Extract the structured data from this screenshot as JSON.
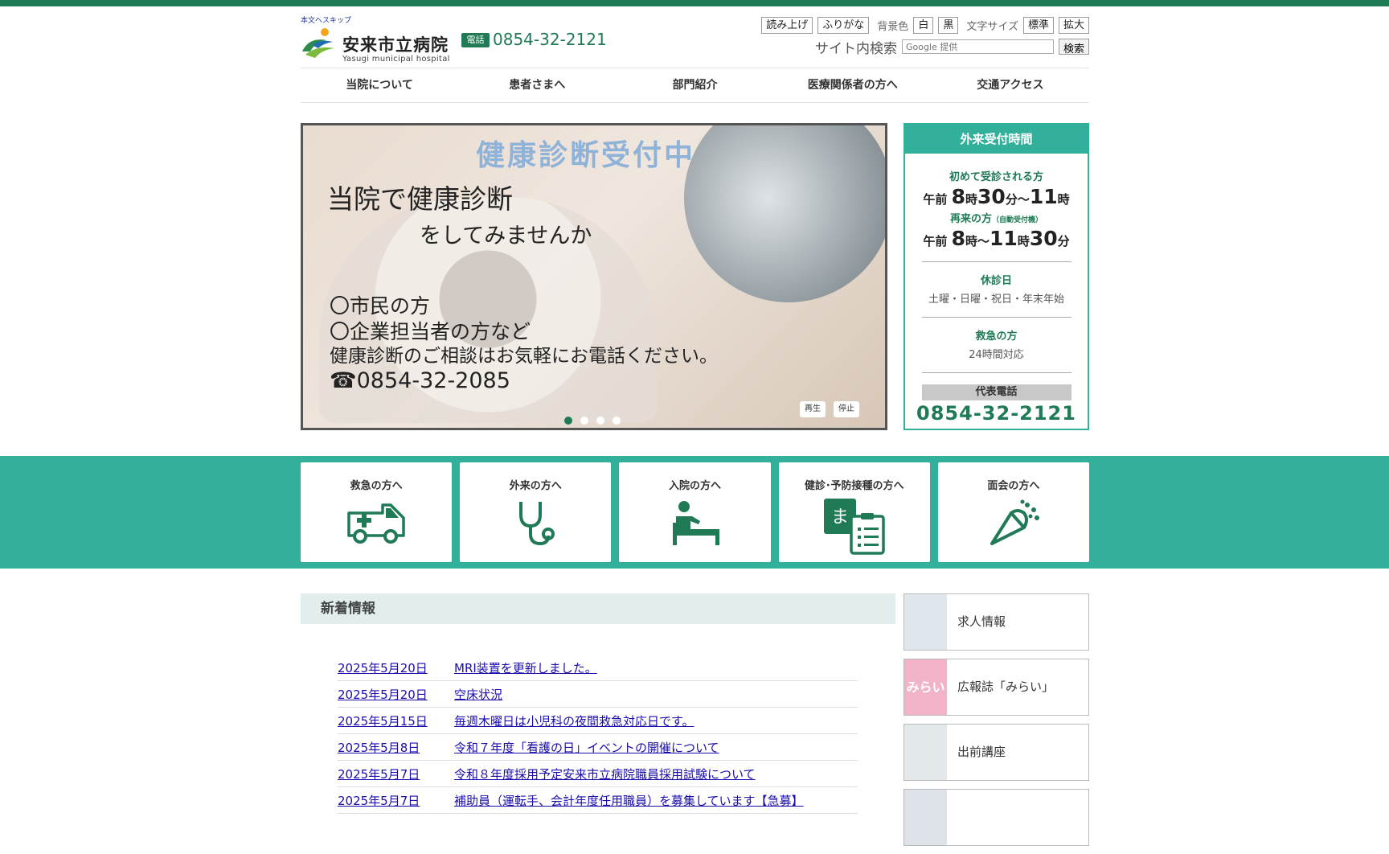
{
  "header": {
    "skip_link": "本文へスキップ",
    "hospital_name": "安来市立病院",
    "hospital_name_en": "Yasugi municipal hospital",
    "tel_badge": "電話",
    "tel_number": "0854-32-2121"
  },
  "utility": {
    "read_aloud": "読み上げ",
    "furigana": "ふりがな",
    "bg_color_label": "背景色",
    "bg_white": "白",
    "bg_black": "黒",
    "font_size_label": "文字サイズ",
    "font_standard": "標準",
    "font_large": "拡大"
  },
  "search": {
    "label": "サイト内検索",
    "placeholder": "Google 提供",
    "button": "検索"
  },
  "nav": {
    "items": [
      "当院について",
      "患者さまへ",
      "部門紹介",
      "医療関係者の方へ",
      "交通アクセス"
    ]
  },
  "slider": {
    "headline": "健康診断受付中",
    "line1": "当院で健康診断",
    "line2": "をしてみませんか",
    "line3": "〇市民の方",
    "line4": "〇企業担当者の方など",
    "line5": "健康診断のご相談はお気軽にお電話ください。",
    "line6": "☎0854-32-2085",
    "play": "再生",
    "stop": "停止",
    "slide_count": 4,
    "active_slide": 1
  },
  "hours": {
    "title": "外来受付時間",
    "first_visit_label": "初めて受診される方",
    "first_visit_time": [
      "午前",
      "8",
      "時",
      "30",
      "分〜",
      "11",
      "時"
    ],
    "return_visit_label": "再来の方",
    "return_visit_note": "（自動受付機）",
    "return_visit_time": [
      "午前",
      "8",
      "時〜",
      "11",
      "時",
      "30",
      "分"
    ],
    "closed_label": "休診日",
    "closed_days": "土曜・日曜・祝日・年末年始",
    "emergency_label": "救急の方",
    "emergency_text": "24時間対応",
    "main_tel_label": "代表電話",
    "main_tel": "0854-32-2121"
  },
  "cards": [
    {
      "label": "救急の方へ",
      "icon": "ambulance-icon"
    },
    {
      "label": "外来の方へ",
      "icon": "stethoscope-icon"
    },
    {
      "label": "入院の方へ",
      "icon": "hospital-bed-icon"
    },
    {
      "label": "健診･予防接種の方へ",
      "icon": "checkup-clipboard-icon"
    },
    {
      "label": "面会の方へ",
      "icon": "party-popper-icon"
    }
  ],
  "news": {
    "title": "新着情報",
    "items": [
      {
        "date": "2025年5月20日",
        "title": "MRI装置を更新しました。"
      },
      {
        "date": "2025年5月20日",
        "title": "空床状況"
      },
      {
        "date": "2025年5月15日",
        "title": "毎週木曜日は小児科の夜間救急対応日です。"
      },
      {
        "date": "2025年5月8日",
        "title": "令和７年度「看護の日」イベントの開催について"
      },
      {
        "date": "2025年5月7日",
        "title": "令和８年度採用予定安来市立病院職員採用試験について"
      },
      {
        "date": "2025年5月7日",
        "title": "補助員（運転手、会計年度任用職員）を募集しています【急募】"
      }
    ]
  },
  "side_banners": [
    {
      "label": "求人情報",
      "thumb_color": "#dfe6ec"
    },
    {
      "label": "広報誌「みらい」",
      "thumb_color": "#f2b3c8",
      "thumb_text": "みらい"
    },
    {
      "label": "出前講座",
      "thumb_color": "#e3e8ea"
    },
    {
      "label": "",
      "thumb_color": "#dde3e8"
    }
  ],
  "colors": {
    "brand_green": "#1f7a55",
    "teal": "#32b09c",
    "link": "#1a0dab"
  }
}
